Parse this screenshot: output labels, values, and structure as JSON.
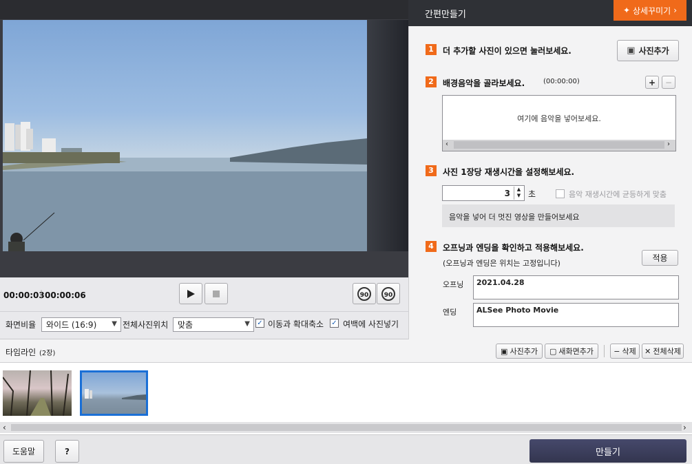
{
  "panel": {
    "title": "간편만들기",
    "detail_button": "상세꾸미기"
  },
  "player": {
    "current_time": "00:00:03",
    "total_time": "00:00:06"
  },
  "options": {
    "aspect_label": "화면비율",
    "aspect_value": "와이드 (16:9)",
    "position_label": "전체사진위치",
    "position_value": "맞춤",
    "pan_zoom_label": "이동과 확대축소",
    "pan_zoom_checked": true,
    "fill_margin_label": "여백에 사진넣기",
    "fill_margin_checked": true
  },
  "steps": {
    "s1": {
      "num": "1",
      "title": "더 추가할 사진이 있으면 눌러보세요.",
      "button": "사진추가"
    },
    "s2": {
      "num": "2",
      "title": "배경음악을 골라보세요.",
      "duration": "(00:00:00)",
      "placeholder": "여기에 음악을 넣어보세요."
    },
    "s3": {
      "num": "3",
      "title": "사진 1장당 재생시간을 설정해보세요.",
      "seconds": "3",
      "unit": "초",
      "sync_label": "음악 재생시간에 균등하게 맞춤",
      "sync_checked": false,
      "hint": "음악을 넣어 더 멋진 영상을 만들어보세요"
    },
    "s4": {
      "num": "4",
      "title": "오프닝과 엔딩을 확인하고 적용해보세요.",
      "note": "(오프닝과 엔딩은 위치는 고정입니다)",
      "apply": "적용",
      "opening_label": "오프닝",
      "opening_value": "2021.04.28",
      "ending_label": "엔딩",
      "ending_value": "ALSee Photo Movie"
    }
  },
  "timeline": {
    "title": "타임라인",
    "count": "(2장)",
    "add_photo": "사진추가",
    "add_new_screen": "새화면추가",
    "delete": "삭제",
    "delete_all": "전체삭제"
  },
  "footer": {
    "help": "도움말",
    "question": "?",
    "make": "만들기"
  },
  "colors": {
    "accent_orange": "#f06a1a",
    "selection_blue": "#1a6fd6",
    "make_button": "#3a3d5c"
  }
}
